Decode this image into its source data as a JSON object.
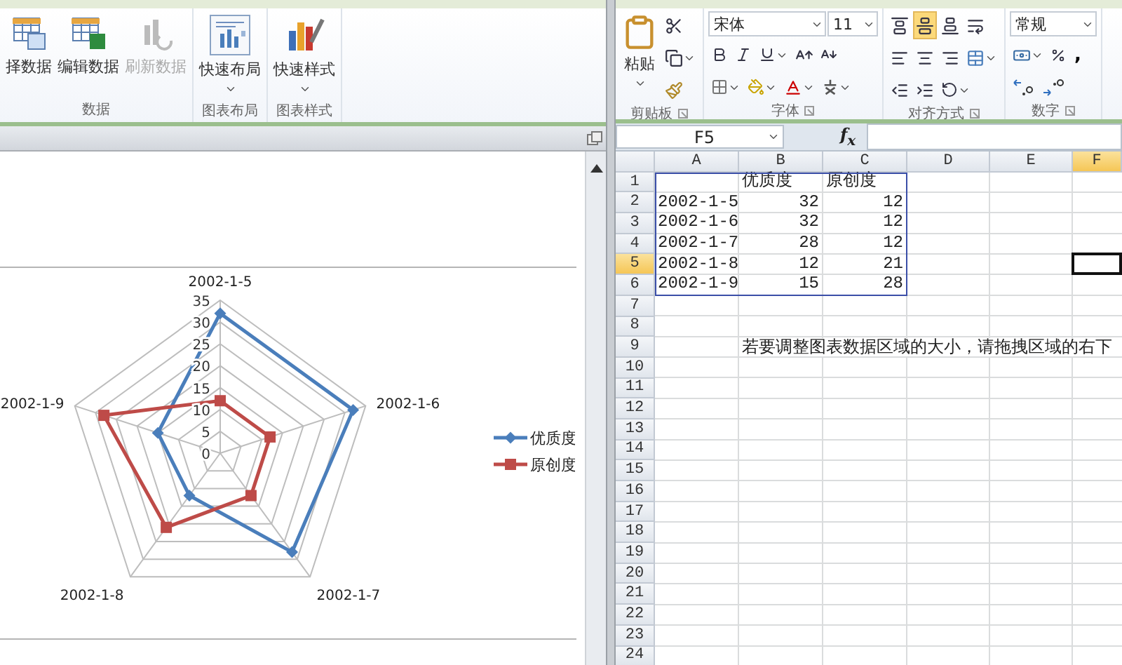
{
  "chart_window": {
    "ribbon_groups": [
      {
        "label": "数据",
        "buttons": [
          {
            "label": "择数据",
            "kind": "select",
            "disabled": false,
            "dropdown": false
          },
          {
            "label": "编辑数据",
            "kind": "edit",
            "disabled": false,
            "dropdown": false
          },
          {
            "label": "刷新数据",
            "kind": "refresh",
            "disabled": true,
            "dropdown": false
          }
        ]
      },
      {
        "label": "图表布局",
        "buttons": [
          {
            "label": "快速布局",
            "kind": "layout",
            "disabled": false,
            "dropdown": true
          }
        ]
      },
      {
        "label": "图表样式",
        "buttons": [
          {
            "label": "快速样式",
            "kind": "style",
            "disabled": false,
            "dropdown": true
          }
        ]
      }
    ],
    "chart": {
      "chart_data": {
        "type": "radar",
        "categories": [
          "2002-1-5",
          "2002-1-6",
          "2002-1-7",
          "2002-1-8",
          "2002-1-9"
        ],
        "series": [
          {
            "name": "优质度",
            "color": "#4a7ebb",
            "values": [
              32,
              32,
              28,
              12,
              15
            ]
          },
          {
            "name": "原创度",
            "color": "#be4b48",
            "values": [
              12,
              12,
              12,
              21,
              28
            ]
          }
        ],
        "ylim": [
          0,
          35
        ],
        "yticks": [
          {
            "value": 0,
            "label": "0"
          },
          {
            "value": 5,
            "label": "5"
          },
          {
            "value": 10,
            "label": "10"
          },
          {
            "value": 15,
            "label": "15"
          },
          {
            "value": 20,
            "label": "20"
          },
          {
            "value": 25,
            "label": "25"
          },
          {
            "value": 30,
            "label": "30"
          },
          {
            "value": 35,
            "label": "35"
          }
        ],
        "legend": "right"
      }
    }
  },
  "excel": {
    "ribbon": {
      "clipboard": {
        "label": "剪贴板",
        "paste": "粘贴"
      },
      "font": {
        "label": "字体",
        "name": "宋体",
        "size": "11"
      },
      "alignment": {
        "label": "对齐方式",
        "vertical": [
          {
            "kind": "top",
            "selected": false
          },
          {
            "kind": "middle",
            "selected": true
          },
          {
            "kind": "bottom",
            "selected": false
          }
        ]
      },
      "number": {
        "label": "数字",
        "format": "常规",
        "comma": ","
      }
    },
    "name_box": "F5",
    "fx": "f$_{x}$",
    "columns": [
      {
        "label": "A",
        "selected": false
      },
      {
        "label": "B",
        "selected": false
      },
      {
        "label": "C",
        "selected": false
      },
      {
        "label": "D",
        "selected": false
      },
      {
        "label": "E",
        "selected": false
      },
      {
        "label": "F",
        "selected": true
      }
    ],
    "rows": [
      {
        "number": "1",
        "selected": false,
        "labels": [
          "优质度",
          "原创度"
        ]
      },
      {
        "number": "2",
        "selected": false,
        "date": "2002-1-5",
        "numbers": [
          "32",
          "12"
        ]
      },
      {
        "number": "3",
        "selected": false,
        "date": "2002-1-6",
        "numbers": [
          "32",
          "12"
        ]
      },
      {
        "number": "4",
        "selected": false,
        "date": "2002-1-7",
        "numbers": [
          "28",
          "12"
        ]
      },
      {
        "number": "5",
        "selected": true,
        "date": "2002-1-8",
        "numbers": [
          "12",
          "21"
        ]
      },
      {
        "number": "6",
        "selected": false,
        "date": "2002-1-9",
        "numbers": [
          "15",
          "28"
        ]
      },
      {
        "number": "7",
        "selected": false
      },
      {
        "number": "8",
        "selected": false
      },
      {
        "number": "9",
        "selected": false,
        "note": "若要调整图表数据区域的大小，请拖拽区域的右下"
      },
      {
        "number": "10",
        "selected": false
      },
      {
        "number": "11",
        "selected": false
      },
      {
        "number": "12",
        "selected": false
      },
      {
        "number": "13",
        "selected": false
      },
      {
        "number": "14",
        "selected": false
      },
      {
        "number": "15",
        "selected": false
      },
      {
        "number": "16",
        "selected": false
      },
      {
        "number": "17",
        "selected": false
      },
      {
        "number": "18",
        "selected": false
      },
      {
        "number": "19",
        "selected": false
      },
      {
        "number": "20",
        "selected": false
      },
      {
        "number": "21",
        "selected": false
      },
      {
        "number": "22",
        "selected": false
      },
      {
        "number": "23",
        "selected": false
      },
      {
        "number": "24",
        "selected": false
      }
    ]
  }
}
